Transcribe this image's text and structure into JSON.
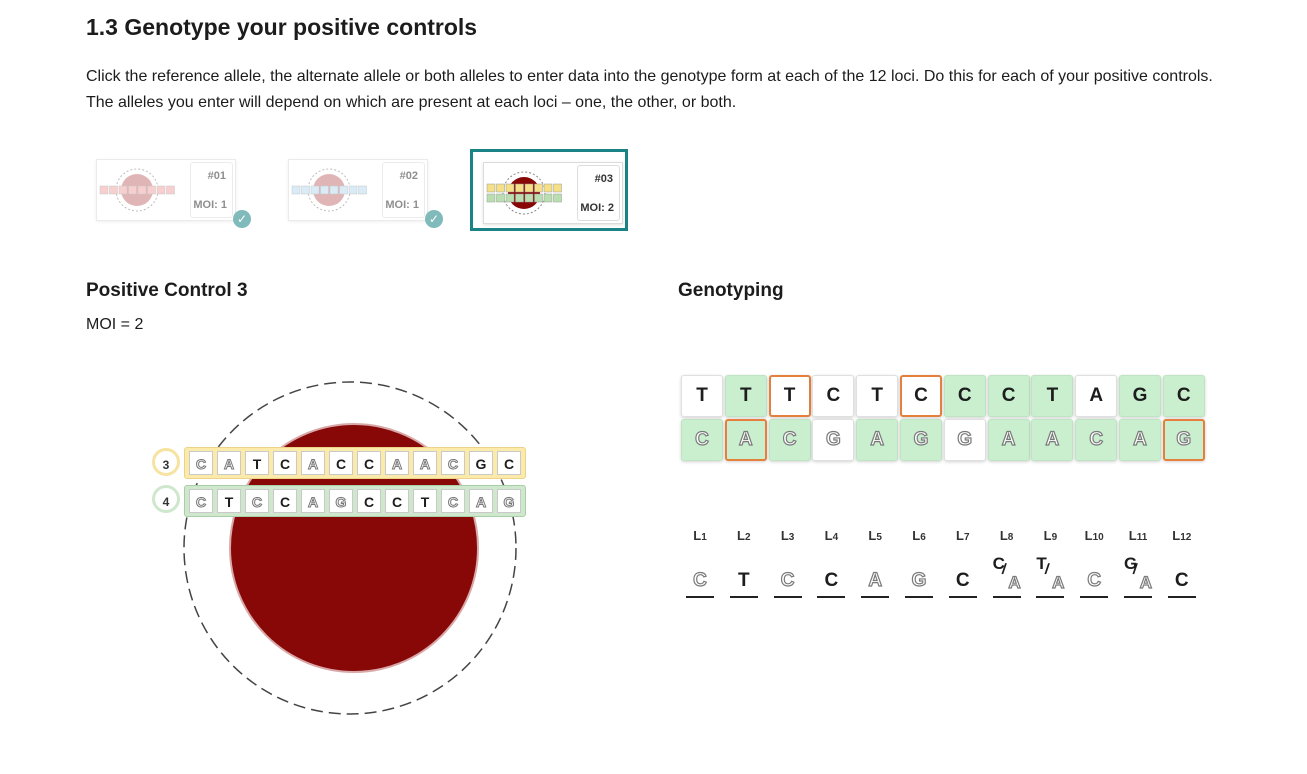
{
  "header": {
    "title": "1.3 Genotype your positive controls",
    "intro": "Click the reference allele, the alternate allele or both alleles to enter data into the genotype form at each of the 12 loci. Do this for each of your positive controls. The alleles you enter will depend on which are present at each loci – one, the other, or both."
  },
  "samples": [
    {
      "number": "#01",
      "moi": "MOI: 1",
      "completed": true,
      "selected": false
    },
    {
      "number": "#02",
      "moi": "MOI: 1",
      "completed": true,
      "selected": false
    },
    {
      "number": "#03",
      "moi": "MOI: 2",
      "completed": false,
      "selected": true
    }
  ],
  "control": {
    "heading": "Positive Control 3",
    "moi_text": "MOI = 2",
    "chromosomes": [
      {
        "badge": "3",
        "color": "#fbeaa9",
        "bases": [
          "C",
          "A",
          "T",
          "C",
          "A",
          "C",
          "C",
          "A",
          "A",
          "C",
          "G",
          "C"
        ],
        "alt": [
          true,
          true,
          false,
          false,
          true,
          false,
          false,
          true,
          true,
          true,
          false,
          false
        ]
      },
      {
        "badge": "4",
        "color": "#cfe7cc",
        "bases": [
          "C",
          "T",
          "C",
          "C",
          "A",
          "G",
          "C",
          "C",
          "T",
          "C",
          "A",
          "G"
        ],
        "alt": [
          true,
          false,
          true,
          false,
          true,
          true,
          false,
          false,
          false,
          true,
          true,
          true
        ]
      }
    ]
  },
  "genotyping": {
    "heading": "Genotyping",
    "ref_row": [
      {
        "allele": "T",
        "shade": "white",
        "selected": false
      },
      {
        "allele": "T",
        "shade": "green",
        "selected": false
      },
      {
        "allele": "T",
        "shade": "white",
        "selected": true
      },
      {
        "allele": "C",
        "shade": "white",
        "selected": false
      },
      {
        "allele": "T",
        "shade": "white",
        "selected": false
      },
      {
        "allele": "C",
        "shade": "white",
        "selected": true
      },
      {
        "allele": "C",
        "shade": "green",
        "selected": false
      },
      {
        "allele": "C",
        "shade": "green",
        "selected": false
      },
      {
        "allele": "T",
        "shade": "green",
        "selected": false
      },
      {
        "allele": "A",
        "shade": "white",
        "selected": false
      },
      {
        "allele": "G",
        "shade": "green",
        "selected": false
      },
      {
        "allele": "C",
        "shade": "green",
        "selected": false
      }
    ],
    "alt_row": [
      {
        "allele": "C",
        "shade": "green",
        "selected": false
      },
      {
        "allele": "A",
        "shade": "green",
        "selected": true
      },
      {
        "allele": "C",
        "shade": "green",
        "selected": false
      },
      {
        "allele": "G",
        "shade": "white",
        "selected": false
      },
      {
        "allele": "A",
        "shade": "green",
        "selected": false
      },
      {
        "allele": "G",
        "shade": "green",
        "selected": false
      },
      {
        "allele": "G",
        "shade": "white",
        "selected": false
      },
      {
        "allele": "A",
        "shade": "green",
        "selected": false
      },
      {
        "allele": "A",
        "shade": "green",
        "selected": false
      },
      {
        "allele": "C",
        "shade": "green",
        "selected": false
      },
      {
        "allele": "A",
        "shade": "green",
        "selected": false
      },
      {
        "allele": "G",
        "shade": "green",
        "selected": true
      }
    ],
    "loci": [
      {
        "label": "L",
        "sub": "1",
        "call": [
          "C"
        ],
        "hollow": [
          true
        ]
      },
      {
        "label": "L",
        "sub": "2",
        "call": [
          "T"
        ],
        "hollow": [
          false
        ]
      },
      {
        "label": "L",
        "sub": "3",
        "call": [
          "C"
        ],
        "hollow": [
          true
        ]
      },
      {
        "label": "L",
        "sub": "4",
        "call": [
          "C"
        ],
        "hollow": [
          false
        ]
      },
      {
        "label": "L",
        "sub": "5",
        "call": [
          "A"
        ],
        "hollow": [
          true
        ]
      },
      {
        "label": "L",
        "sub": "6",
        "call": [
          "G"
        ],
        "hollow": [
          true
        ]
      },
      {
        "label": "L",
        "sub": "7",
        "call": [
          "C"
        ],
        "hollow": [
          false
        ]
      },
      {
        "label": "L",
        "sub": "8",
        "call": [
          "C",
          "A"
        ],
        "hollow": [
          false,
          true
        ]
      },
      {
        "label": "L",
        "sub": "9",
        "call": [
          "T",
          "A"
        ],
        "hollow": [
          false,
          true
        ]
      },
      {
        "label": "L",
        "sub": "10",
        "call": [
          "C"
        ],
        "hollow": [
          true
        ]
      },
      {
        "label": "L",
        "sub": "11",
        "call": [
          "G",
          "A"
        ],
        "hollow": [
          false,
          true
        ]
      },
      {
        "label": "L",
        "sub": "12",
        "call": [
          "C"
        ],
        "hollow": [
          false
        ]
      }
    ]
  },
  "colors": {
    "accent": "#1b8385",
    "selection": "#e5803c",
    "cell": "#880808",
    "cell_green": "#c9efcf"
  }
}
